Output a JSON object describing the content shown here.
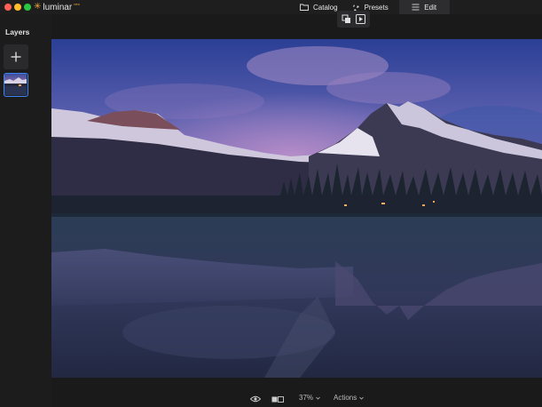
{
  "app": {
    "name": "luminar",
    "edition": "neo",
    "brand_color": "#f2a93b"
  },
  "nav": {
    "catalog_label": "Catalog",
    "presets_label": "Presets",
    "edit_label": "Edit",
    "active": "Edit"
  },
  "sidebar": {
    "title": "Layers"
  },
  "bottom": {
    "zoom": "37%",
    "actions_label": "Actions"
  },
  "colors": {
    "background": "#1a1a1b",
    "selection": "#3e82f7",
    "panel": "#2a2a2c"
  },
  "icons": [
    "folder-icon",
    "presets-icon",
    "edit-sliders-icon",
    "crop-layer-icon",
    "export-play-icon",
    "plus-icon",
    "eye-icon",
    "compare-icon",
    "chevron-down-icon"
  ]
}
